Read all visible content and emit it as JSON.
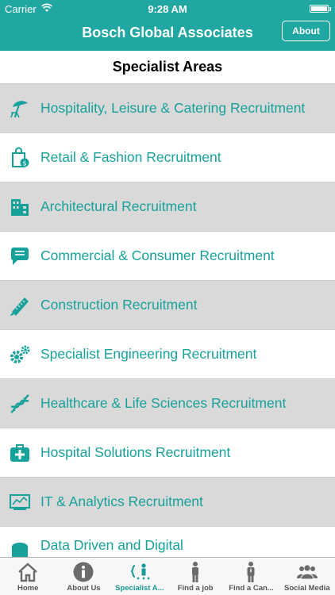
{
  "status": {
    "carrier": "Carrier",
    "time": "9:28 AM"
  },
  "nav": {
    "title": "Bosch Global Associates",
    "about_label": "About"
  },
  "section": {
    "title": "Specialist Areas"
  },
  "colors": {
    "accent": "#20a7a1",
    "text_accent": "#17a19b",
    "row_alt": "#d9d9d9"
  },
  "items": [
    {
      "label": "Hospitality, Leisure & Catering Recruitment",
      "icon": "beach-umbrella-icon"
    },
    {
      "label": "Retail & Fashion Recruitment",
      "icon": "shopping-bag-icon"
    },
    {
      "label": "Architectural Recruitment",
      "icon": "building-icon"
    },
    {
      "label": "Commercial & Consumer Recruitment",
      "icon": "speech-bubble-icon"
    },
    {
      "label": "Construction Recruitment",
      "icon": "saw-icon"
    },
    {
      "label": "Specialist Engineering Recruitment",
      "icon": "gears-icon"
    },
    {
      "label": "Healthcare & Life Sciences Recruitment",
      "icon": "dna-icon"
    },
    {
      "label": "Hospital Solutions Recruitment",
      "icon": "medical-kit-icon"
    },
    {
      "label": "IT & Analytics Recruitment",
      "icon": "monitor-chart-icon"
    },
    {
      "label": "Data Driven and Digital",
      "icon": "data-icon"
    }
  ],
  "tabs": [
    {
      "label": "Home",
      "icon": "home-icon",
      "active": false
    },
    {
      "label": "About Us",
      "icon": "info-icon",
      "active": false
    },
    {
      "label": "Specialist A...",
      "icon": "specialist-icon",
      "active": true
    },
    {
      "label": "Find a job",
      "icon": "person-icon",
      "active": false
    },
    {
      "label": "Find a Can...",
      "icon": "person-suit-icon",
      "active": false
    },
    {
      "label": "Social Media",
      "icon": "group-icon",
      "active": false
    }
  ]
}
